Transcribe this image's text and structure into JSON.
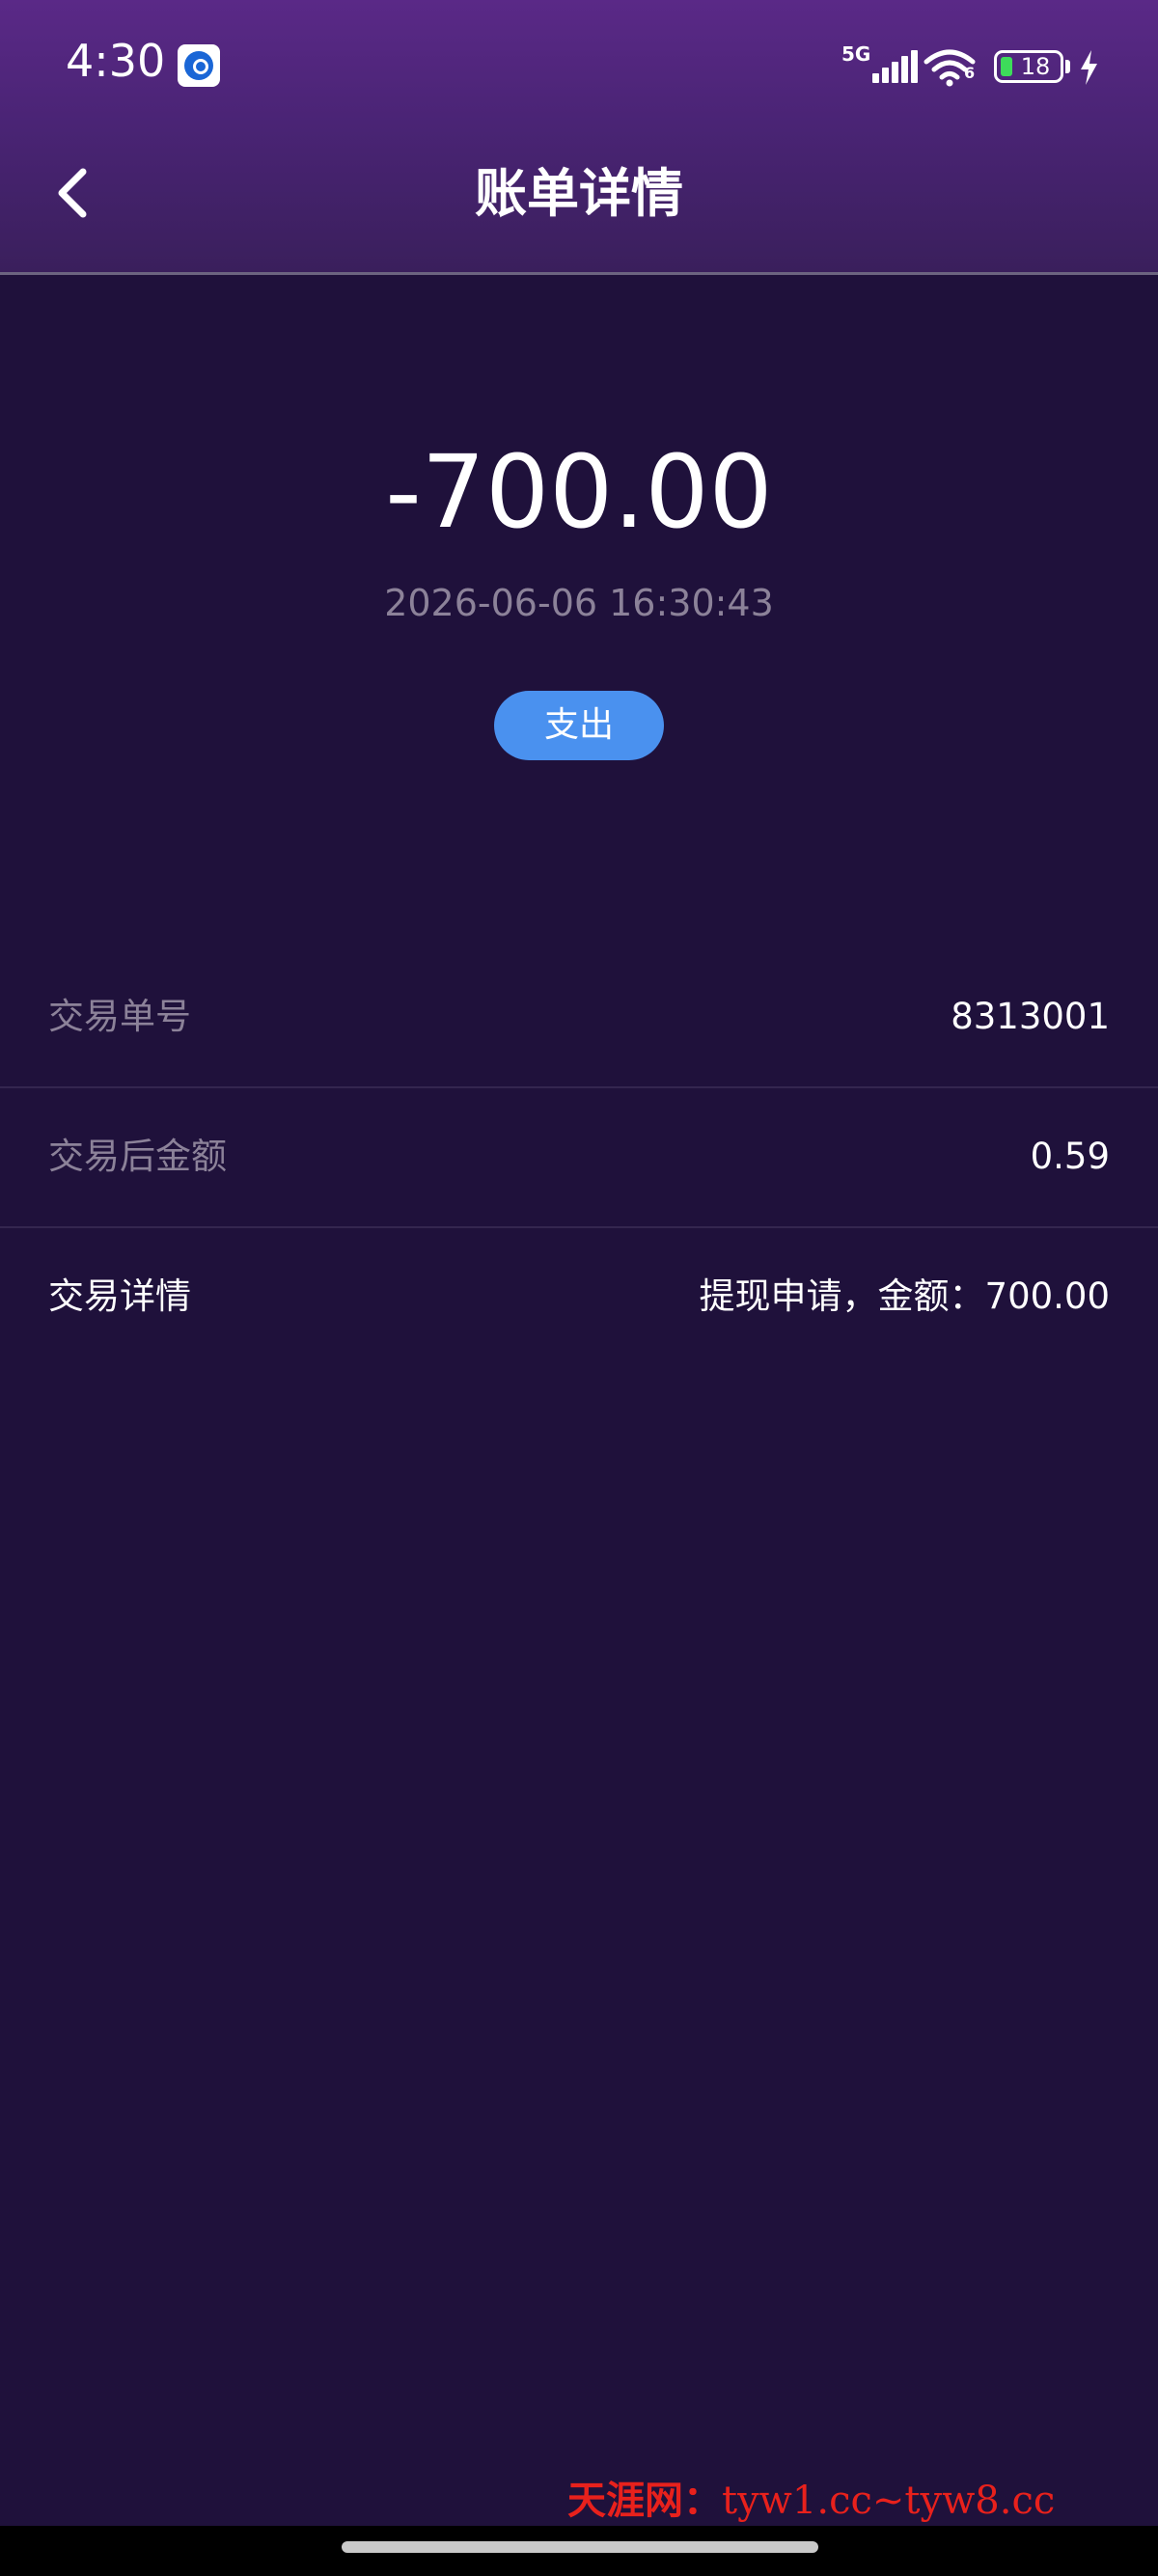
{
  "status_bar": {
    "time": "4:30",
    "network": "5G",
    "wifi_sub": "6",
    "battery_level": "18",
    "icons": [
      "app-notification-icon",
      "signal-icon",
      "wifi-icon",
      "battery-icon",
      "charging-icon"
    ]
  },
  "header": {
    "title": "账单详情",
    "back_icon": "chevron-left-icon"
  },
  "summary": {
    "amount": "-700.00",
    "datetime": "2026-06-06 16:30:43",
    "type_badge": "支出"
  },
  "details": [
    {
      "label": "交易单号",
      "value": "8313001"
    },
    {
      "label": "交易后金额",
      "value": "0.59"
    },
    {
      "label": "交易详情",
      "value": "提现申请，金额：700.00"
    }
  ],
  "watermark": {
    "brand": "天涯网：",
    "urls": "tyw1.cc~tyw8.cc"
  },
  "colors": {
    "background": "#1f113b",
    "header_top": "#5a2987",
    "badge": "#4a91ef",
    "muted_text": "#8c8299",
    "watermark": "#e8211c"
  }
}
